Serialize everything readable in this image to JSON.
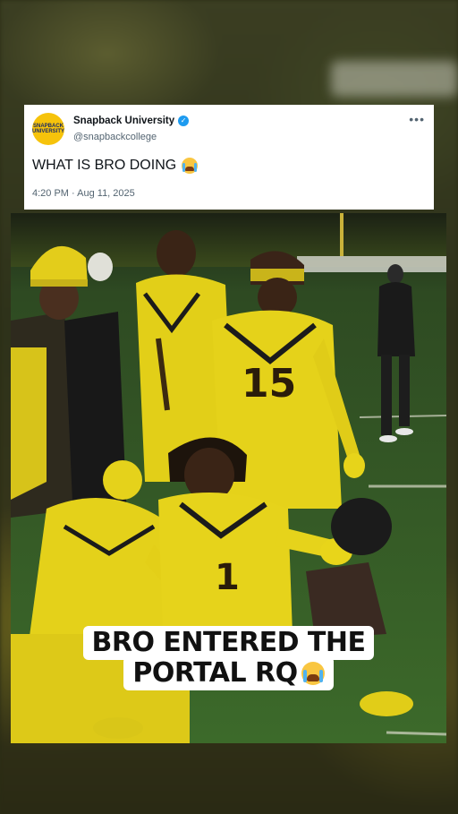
{
  "tweet": {
    "account_name": "Snapback University",
    "handle": "@snapbackcollege",
    "avatar_text": "SNAPBACK UNIVERSITY",
    "text": "WHAT IS BRO DOING",
    "text_emoji": "loudly-crying-face",
    "timestamp": "4:20 PM · Aug 11, 2025",
    "more_icon": "more-horizontal-icon",
    "verified_icon": "verified-badge-icon"
  },
  "video": {
    "caption_line1": "BRO ENTERED THE",
    "caption_line2": "PORTAL RQ",
    "caption_emoji": "loudly-crying-face",
    "jersey_number": "15"
  },
  "colors": {
    "jersey_yellow": "#e6d21a",
    "field_green": "#2f5a22",
    "verified_blue": "#1d9bf0"
  }
}
